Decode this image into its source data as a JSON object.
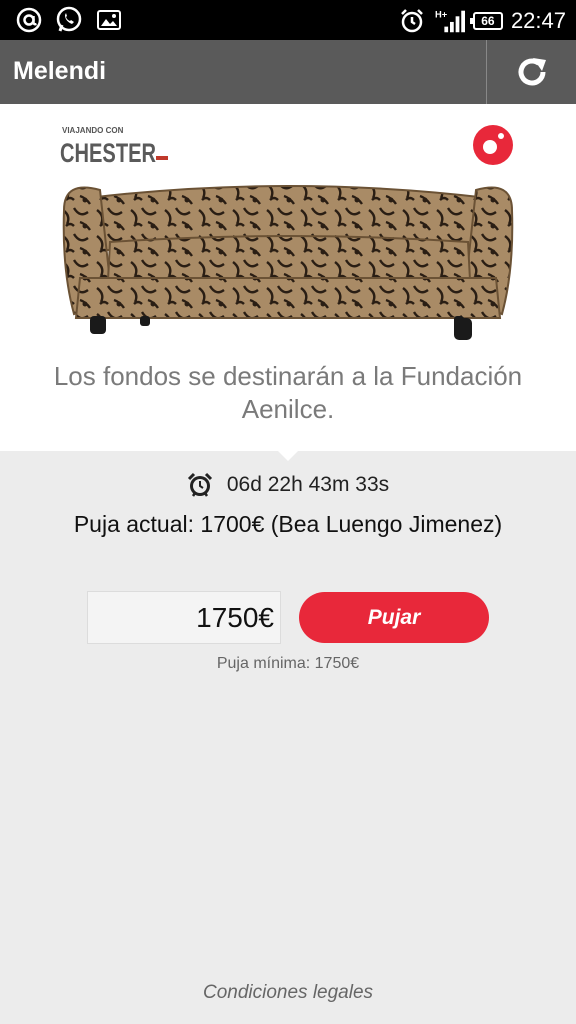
{
  "status_bar": {
    "left_icons": [
      "at-sign-icon",
      "whatsapp-icon",
      "gallery-icon"
    ],
    "right_icons": [
      "alarm-icon",
      "signal-hplus-icon",
      "battery-icon"
    ],
    "network_label": "H+",
    "battery_level": "66",
    "time": "22:47"
  },
  "action_bar": {
    "title": "Melendi",
    "refresh_icon": "refresh-icon",
    "bg_color": "#5a5a5a"
  },
  "product": {
    "brand_logo_top": "VIAJANDO CON",
    "brand_logo_main": "CHESTER",
    "record_icon": "record-icon",
    "image": "chesterfield-sofa",
    "description": "Los fondos se destinarán a la Fundación Aenilce."
  },
  "bidding": {
    "countdown_icon": "alarm-clock-icon",
    "countdown": "06d 22h 43m 33s",
    "current_bid": "Puja actual: 1700€ (Bea Luengo Jimenez)",
    "bid_value": "1750€",
    "bid_button_label": "Pujar",
    "minimum_bid": "Puja mínima: 1750€"
  },
  "footer": {
    "legal_link": "Condiciones legales"
  },
  "colors": {
    "accent": "#e8283a",
    "status_bar": "#000000",
    "page_bg": "#ececec"
  }
}
